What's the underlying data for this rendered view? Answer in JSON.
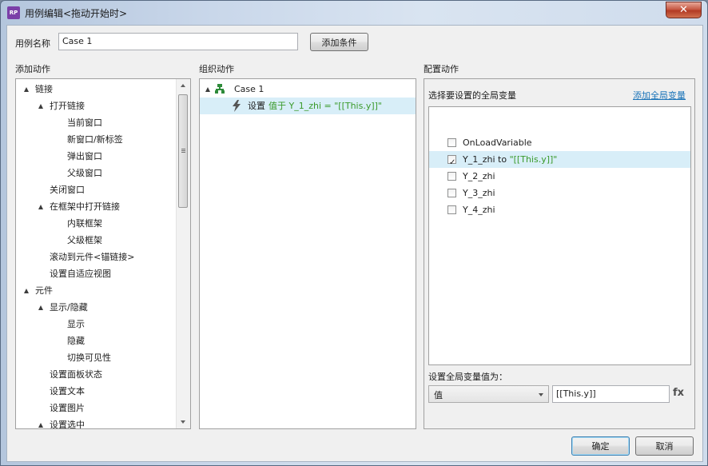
{
  "window": {
    "title": "用例编辑<拖动开始时>",
    "icon_text": "RP",
    "close_glyph": "✕"
  },
  "case_name": {
    "label": "用例名称",
    "value": "Case 1",
    "add_condition": "添加条件"
  },
  "add_actions": {
    "header": "添加动作",
    "items": [
      {
        "label": "链接",
        "level": 0,
        "expanded": true
      },
      {
        "label": "打开链接",
        "level": 1,
        "expanded": true
      },
      {
        "label": "当前窗口",
        "level": 2
      },
      {
        "label": "新窗口/新标签",
        "level": 2
      },
      {
        "label": "弹出窗口",
        "level": 2
      },
      {
        "label": "父级窗口",
        "level": 2
      },
      {
        "label": "关闭窗口",
        "level": 1
      },
      {
        "label": "在框架中打开链接",
        "level": 1,
        "expanded": true
      },
      {
        "label": "内联框架",
        "level": 2
      },
      {
        "label": "父级框架",
        "level": 2
      },
      {
        "label": "滚动到元件<锚链接>",
        "level": 1
      },
      {
        "label": "设置自适应视图",
        "level": 1
      },
      {
        "label": "元件",
        "level": 0,
        "expanded": true
      },
      {
        "label": "显示/隐藏",
        "level": 1,
        "expanded": true
      },
      {
        "label": "显示",
        "level": 2
      },
      {
        "label": "隐藏",
        "level": 2
      },
      {
        "label": "切换可见性",
        "level": 2
      },
      {
        "label": "设置面板状态",
        "level": 1
      },
      {
        "label": "设置文本",
        "level": 1
      },
      {
        "label": "设置图片",
        "level": 1
      },
      {
        "label": "设置选中",
        "level": 1,
        "expanded": true
      }
    ]
  },
  "organize": {
    "header": "组织动作",
    "case_label": "Case 1",
    "action_prefix": "设置",
    "action_detail": "值于 Y_1_zhi = \"[[This.y]]\""
  },
  "configure": {
    "header": "配置动作",
    "select_label": "选择要设置的全局变量",
    "add_global_link": "添加全局变量",
    "variables": [
      {
        "name": "OnLoadVariable",
        "checked": false,
        "suffix": ""
      },
      {
        "name": "Y_1_zhi",
        "checked": true,
        "suffix": " to ",
        "value": "\"[[This.y]]\""
      },
      {
        "name": "Y_2_zhi",
        "checked": false,
        "suffix": ""
      },
      {
        "name": "Y_3_zhi",
        "checked": false,
        "suffix": ""
      },
      {
        "name": "Y_4_zhi",
        "checked": false,
        "suffix": ""
      }
    ],
    "set_value_label": "设置全局变量值为：",
    "value_type": "值",
    "value_text": "[[This.y]]",
    "fx_label": "fx"
  },
  "footer": {
    "ok": "确定",
    "cancel": "取消"
  }
}
